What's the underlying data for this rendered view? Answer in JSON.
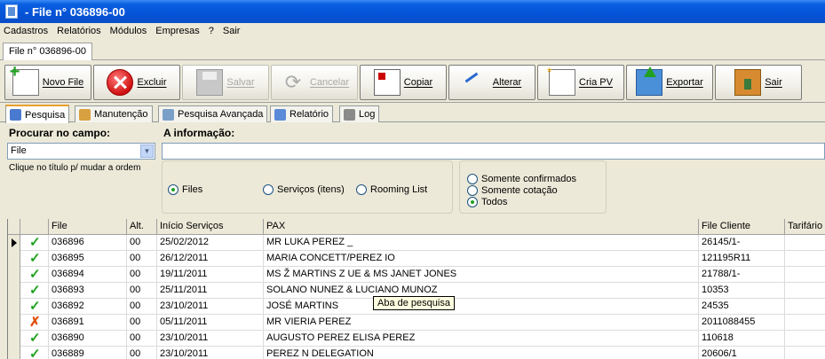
{
  "window": {
    "title": "- File n° 036896-00"
  },
  "menu": [
    "Cadastros",
    "Relatórios",
    "Módulos",
    "Empresas",
    "?",
    "Sair"
  ],
  "doc_tab": "File n° 036896-00",
  "toolbar": {
    "novo": "Novo File",
    "excluir": "Excluir",
    "salvar": "Salvar",
    "cancelar": "Cancelar",
    "copiar": "Copiar",
    "alterar": "Alterar",
    "cria_pv": "Cria PV",
    "exportar": "Exportar",
    "sair": "Sair"
  },
  "tabs": {
    "pesquisa": "Pesquisa",
    "manutencao": "Manutenção",
    "avancada": "Pesquisa Avançada",
    "relatorio": "Relatório",
    "log": "Log"
  },
  "search": {
    "field_label": "Procurar no campo:",
    "field_value": "File",
    "info_label": "A informação:",
    "info_value": "",
    "hint": "Clique no título p/ mudar a ordem",
    "scope": {
      "files": "Files",
      "servicos": "Serviços (itens)",
      "rooming": "Rooming List",
      "selected": "files"
    },
    "status": {
      "confirmados": "Somente confirmados",
      "cotacao": "Somente cotação",
      "todos": "Todos",
      "selected": "todos"
    }
  },
  "grid": {
    "headers": {
      "file": "File",
      "alt": "Alt.",
      "inicio": "Início Serviços",
      "pax": "PAX",
      "file_cliente": "File Cliente",
      "tarifario": "Tarifário"
    },
    "rows": [
      {
        "status": "ok",
        "file": "036896",
        "alt": "00",
        "inicio": "25/02/2012",
        "pax": "MR LUKA PEREZ  _",
        "file_cliente": "26145/1-"
      },
      {
        "status": "ok",
        "file": "036895",
        "alt": "00",
        "inicio": "26/12/2011",
        "pax": "MARIA CONCETT/PEREZ  IO",
        "file_cliente": "121195R11"
      },
      {
        "status": "ok",
        "file": "036894",
        "alt": "00",
        "inicio": "19/11/2011",
        "pax": "MS Ž MARTINS   Z  UE & MS JANET JONES",
        "file_cliente": "21788/1-"
      },
      {
        "status": "ok",
        "file": "036893",
        "alt": "00",
        "inicio": "25/11/2011",
        "pax": "SOLANO NUNEZ & LUCIANO MUNOZ",
        "file_cliente": "10353"
      },
      {
        "status": "ok",
        "file": "036892",
        "alt": "00",
        "inicio": "23/10/2011",
        "pax": "JOSÉ MARTINS",
        "file_cliente": "24535"
      },
      {
        "status": "cancel",
        "file": "036891",
        "alt": "00",
        "inicio": "05/11/2011",
        "pax": "MR VIERIA PEREZ",
        "file_cliente": "2011088455"
      },
      {
        "status": "ok",
        "file": "036890",
        "alt": "00",
        "inicio": "23/10/2011",
        "pax": "AUGUSTO PEREZ   ELISA PEREZ",
        "file_cliente": "110618"
      },
      {
        "status": "ok",
        "file": "036889",
        "alt": "00",
        "inicio": "23/10/2011",
        "pax": "PEREZ  N DELEGATION",
        "file_cliente": "20606/1"
      }
    ]
  },
  "tooltip": "Aba de pesquisa"
}
